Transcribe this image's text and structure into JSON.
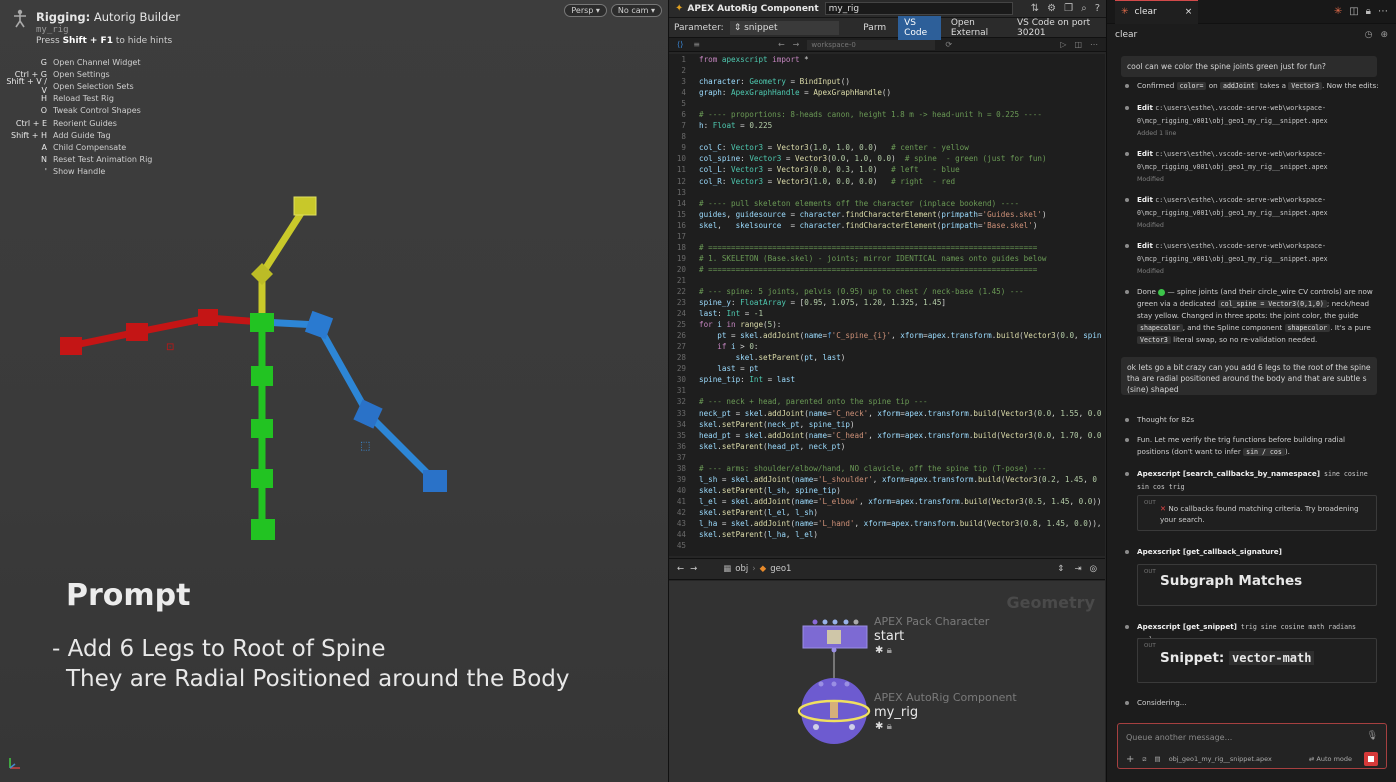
{
  "viewport": {
    "title_bold": "Rigging:",
    "title_rest": " Autorig Builder",
    "rig_name": "my_rig",
    "hint_pre": "Press ",
    "hint_key": "Shift + F1",
    "hint_post": " to hide hints",
    "cam_buttons": [
      "Persp ▾",
      "No cam ▾"
    ],
    "hotkeys": [
      {
        "key": "G",
        "label": "Open Channel Widget"
      },
      {
        "key": "Ctrl + G",
        "label": "Open Settings"
      },
      {
        "key": "Shift + V / V",
        "label": "Open Selection Sets"
      },
      {
        "key": "H",
        "label": "Reload Test Rig"
      },
      {
        "key": "O",
        "label": "Tweak Control Shapes"
      },
      {
        "key": "Ctrl + E",
        "label": "Reorient Guides"
      },
      {
        "key": "Shift + H",
        "label": "Add Guide Tag"
      },
      {
        "key": "A",
        "label": "Child Compensate"
      },
      {
        "key": "N",
        "label": "Reset Test Animation Rig"
      },
      {
        "key": "'",
        "label": "Show Handle"
      }
    ],
    "prompt_title": "Prompt",
    "prompt_line1": "- Add 6 Legs to Root of Spine",
    "prompt_line2": "They are Radial Positioned around the Body",
    "colors": {
      "spine": "#22cc22",
      "neck": "#cccc22",
      "left": "#2277dd",
      "right": "#cc1111"
    }
  },
  "apex": {
    "title": "APEX AutoRig Component",
    "field_value": "my_rig",
    "param_label": "Parameter:",
    "param_value": "snippet",
    "tabs": [
      "Parm",
      "VS Code",
      "Open External",
      "VS Code on port 30201"
    ],
    "vs_search": "workspace-0"
  },
  "code_lines": [
    "<span class='k'>from</span> <span class='t'>apexscript</span> <span class='k'>import</span> *",
    "",
    "<span class='v'>character</span>: <span class='t'>Geometry</span> = <span class='f'>BindInput</span>()",
    "<span class='v'>graph</span>: <span class='t'>ApexGraphHandle</span> = <span class='f'>ApexGraphHandle</span>()",
    "",
    "<span class='c'># ---- proportions: 8-heads canon, height 1.8 m -> head-unit h = 0.225 ----</span>",
    "<span class='v'>h</span>: <span class='t'>Float</span> = <span class='n'>0.225</span>",
    "",
    "<span class='v'>col_C</span>: <span class='t'>Vector3</span> = <span class='f'>Vector3</span>(<span class='n'>1.0</span>, <span class='n'>1.0</span>, <span class='n'>0.0</span>)   <span class='c'># center - yellow</span>",
    "<span class='v'>col_spine</span>: <span class='t'>Vector3</span> = <span class='f'>Vector3</span>(<span class='n'>0.0</span>, <span class='n'>1.0</span>, <span class='n'>0.0</span>)  <span class='c'># spine  - green (just for fun)</span>",
    "<span class='v'>col_L</span>: <span class='t'>Vector3</span> = <span class='f'>Vector3</span>(<span class='n'>0.0</span>, <span class='n'>0.3</span>, <span class='n'>1.0</span>)   <span class='c'># left   - blue</span>",
    "<span class='v'>col_R</span>: <span class='t'>Vector3</span> = <span class='f'>Vector3</span>(<span class='n'>1.0</span>, <span class='n'>0.0</span>, <span class='n'>0.0</span>)   <span class='c'># right  - red</span>",
    "",
    "<span class='c'># ---- pull skeleton elements off the character (inplace bookend) ----</span>",
    "<span class='v'>guides</span>, <span class='v'>guidesource</span> = <span class='v'>character</span>.<span class='f'>findCharacterElement</span>(<span class='v'>primpath</span>=<span class='s'>'Guides.skel'</span>)",
    "<span class='v'>skel</span>,   <span class='v'>skelsource</span>  = <span class='v'>character</span>.<span class='f'>findCharacterElement</span>(<span class='v'>primpath</span>=<span class='s'>'Base.skel'</span>)",
    "",
    "<span class='c'># ========================================================================</span>",
    "<span class='c'># 1. SKELETON (Base.skel) - joints; mirror IDENTICAL names onto guides below</span>",
    "<span class='c'># ========================================================================</span>",
    "",
    "<span class='c'># --- spine: 5 joints, pelvis (0.95) up to chest / neck-base (1.45) ---</span>",
    "<span class='v'>spine_y</span>: <span class='t'>FloatArray</span> = [<span class='n'>0.95</span>, <span class='n'>1.075</span>, <span class='n'>1.20</span>, <span class='n'>1.325</span>, <span class='n'>1.45</span>]",
    "<span class='v'>last</span>: <span class='t'>Int</span> = <span class='n'>-1</span>",
    "<span class='k'>for</span> <span class='v'>i</span> <span class='k'>in</span> <span class='f'>range</span>(<span class='n'>5</span>):",
    "    <span class='v'>pt</span> = <span class='v'>skel</span>.<span class='f'>addJoint</span>(<span class='v'>name</span>=<span class='b'>f</span><span class='s'>'C_spine_{i}'</span>, <span class='v'>xform</span>=<span class='v'>apex</span>.<span class='v'>transform</span>.<span class='f'>build</span>(<span class='f'>Vector3</span>(<span class='n'>0.0</span>, <span class='v'>spin</span>",
    "    <span class='k'>if</span> <span class='v'>i</span> > <span class='n'>0</span>:",
    "        <span class='v'>skel</span>.<span class='f'>setParent</span>(<span class='v'>pt</span>, <span class='v'>last</span>)",
    "    <span class='v'>last</span> = <span class='v'>pt</span>",
    "<span class='v'>spine_tip</span>: <span class='t'>Int</span> = <span class='v'>last</span>",
    "",
    "<span class='c'># --- neck + head, parented onto the spine tip ---</span>",
    "<span class='v'>neck_pt</span> = <span class='v'>skel</span>.<span class='f'>addJoint</span>(<span class='v'>name</span>=<span class='s'>'C_neck'</span>, <span class='v'>xform</span>=<span class='v'>apex</span>.<span class='v'>transform</span>.<span class='f'>build</span>(<span class='f'>Vector3</span>(<span class='n'>0.0</span>, <span class='n'>1.55</span>, <span class='n'>0.0</span>",
    "<span class='v'>skel</span>.<span class='f'>setParent</span>(<span class='v'>neck_pt</span>, <span class='v'>spine_tip</span>)",
    "<span class='v'>head_pt</span> = <span class='v'>skel</span>.<span class='f'>addJoint</span>(<span class='v'>name</span>=<span class='s'>'C_head'</span>, <span class='v'>xform</span>=<span class='v'>apex</span>.<span class='v'>transform</span>.<span class='f'>build</span>(<span class='f'>Vector3</span>(<span class='n'>0.0</span>, <span class='n'>1.70</span>, <span class='n'>0.0</span>",
    "<span class='v'>skel</span>.<span class='f'>setParent</span>(<span class='v'>head_pt</span>, <span class='v'>neck_pt</span>)",
    "",
    "<span class='c'># --- arms: shoulder/elbow/hand, NO clavicle, off the spine tip (T-pose) ---</span>",
    "<span class='v'>l_sh</span> = <span class='v'>skel</span>.<span class='f'>addJoint</span>(<span class='v'>name</span>=<span class='s'>'L_shoulder'</span>, <span class='v'>xform</span>=<span class='v'>apex</span>.<span class='v'>transform</span>.<span class='f'>build</span>(<span class='f'>Vector3</span>(<span class='n'>0.2</span>, <span class='n'>1.45</span>, <span class='n'>0</span>",
    "<span class='v'>skel</span>.<span class='f'>setParent</span>(<span class='v'>l_sh</span>, <span class='v'>spine_tip</span>)",
    "<span class='v'>l_el</span> = <span class='v'>skel</span>.<span class='f'>addJoint</span>(<span class='v'>name</span>=<span class='s'>'L_elbow'</span>, <span class='v'>xform</span>=<span class='v'>apex</span>.<span class='v'>transform</span>.<span class='f'>build</span>(<span class='f'>Vector3</span>(<span class='n'>0.5</span>, <span class='n'>1.45</span>, <span class='n'>0.0</span>))",
    "<span class='v'>skel</span>.<span class='f'>setParent</span>(<span class='v'>l_el</span>, <span class='v'>l_sh</span>)",
    "<span class='v'>l_ha</span> = <span class='v'>skel</span>.<span class='f'>addJoint</span>(<span class='v'>name</span>=<span class='s'>'L_hand'</span>, <span class='v'>xform</span>=<span class='v'>apex</span>.<span class='v'>transform</span>.<span class='f'>build</span>(<span class='f'>Vector3</span>(<span class='n'>0.8</span>, <span class='n'>1.45</span>, <span class='n'>0.0</span>)),",
    "<span class='v'>skel</span>.<span class='f'>setParent</span>(<span class='v'>l_ha</span>, <span class='v'>l_el</span>)",
    ""
  ],
  "geo": {
    "crumb_obj": "obj",
    "crumb_geo": "geo1",
    "network_label": "Geometry",
    "node1_type": "APEX Pack Character",
    "node1_name": "start",
    "node2_type": "APEX AutoRig Component",
    "node2_name": "my_rig"
  },
  "chat": {
    "tab": "clear",
    "head": "clear",
    "user1": "cool can we color the spine joints green just for fun?",
    "confirmed_pre": "Confirmed ",
    "confirmed_chip1": "color=",
    "confirmed_mid": " on ",
    "confirmed_chip2": "addJoint",
    "confirmed_mid2": " takes a ",
    "confirmed_chip3": "Vector3",
    "confirmed_post": ". Now the edits:",
    "edits": [
      {
        "label": "Edit",
        "path": "c:\\users\\esthe\\.vscode-serve-web\\workspace-0\\mcp_rigging_v001\\obj_geo1_my_rig__snippet.apex",
        "meta": "Added 1 line"
      },
      {
        "label": "Edit",
        "path": "c:\\users\\esthe\\.vscode-serve-web\\workspace-0\\mcp_rigging_v001\\obj_geo1_my_rig__snippet.apex",
        "meta": "Modified"
      },
      {
        "label": "Edit",
        "path": "c:\\users\\esthe\\.vscode-serve-web\\workspace-0\\mcp_rigging_v001\\obj_geo1_my_rig__snippet.apex",
        "meta": "Modified"
      },
      {
        "label": "Edit",
        "path": "c:\\users\\esthe\\.vscode-serve-web\\workspace-0\\mcp_rigging_v001\\obj_geo1_my_rig__snippet.apex",
        "meta": "Modified"
      }
    ],
    "done_pre": "Done",
    "done_text1": " — spine joints (and their circle_wire CV controls) are now green via a dedicated ",
    "done_chip1": "col_spine = Vector3(0,1,0)",
    "done_text2": "; neck/head stay yellow. Changed in three spots: the joint color, the guide ",
    "done_chip2": "shapecolor",
    "done_text3": ", and the Spline component ",
    "done_chip3": "shapecolor",
    "done_text4": ". It's a pure ",
    "done_chip4": "Vector3",
    "done_text5": " literal swap, so no re-validation needed.",
    "user2": "ok lets go a bit crazy can you add 6 legs to the root of the spine tha are radial positioned around the body and that are subtle s (sine) shaped",
    "thought": "Thought for 82s",
    "fun": "Fun. Let me verify the trig functions before building radial positions (don't want to infer ",
    "fun_chip": "sin / cos",
    "fun_post": ").",
    "tool1_label": "Apexscript [search_callbacks_by_namespace]",
    "tool1_args": " sine cosine sin cos trig",
    "tool1_out": "No callbacks found matching criteria. Try broadening your search.",
    "tool2_label": "Apexscript [get_callback_signature]",
    "tool2_out": "Subgraph Matches",
    "tool3_label": "Apexscript [get_snippet]",
    "tool3_args": " trig sine cosine math radians angle",
    "tool3_out_pre": "Snippet: ",
    "tool3_out_mono": "vector-math",
    "out_tag": "OUT",
    "considering": "Considering...",
    "input_placeholder": "Queue another message...",
    "attached_file": "obj_geo1_my_rig__snippet.apex",
    "auto_mode": "Auto mode"
  }
}
